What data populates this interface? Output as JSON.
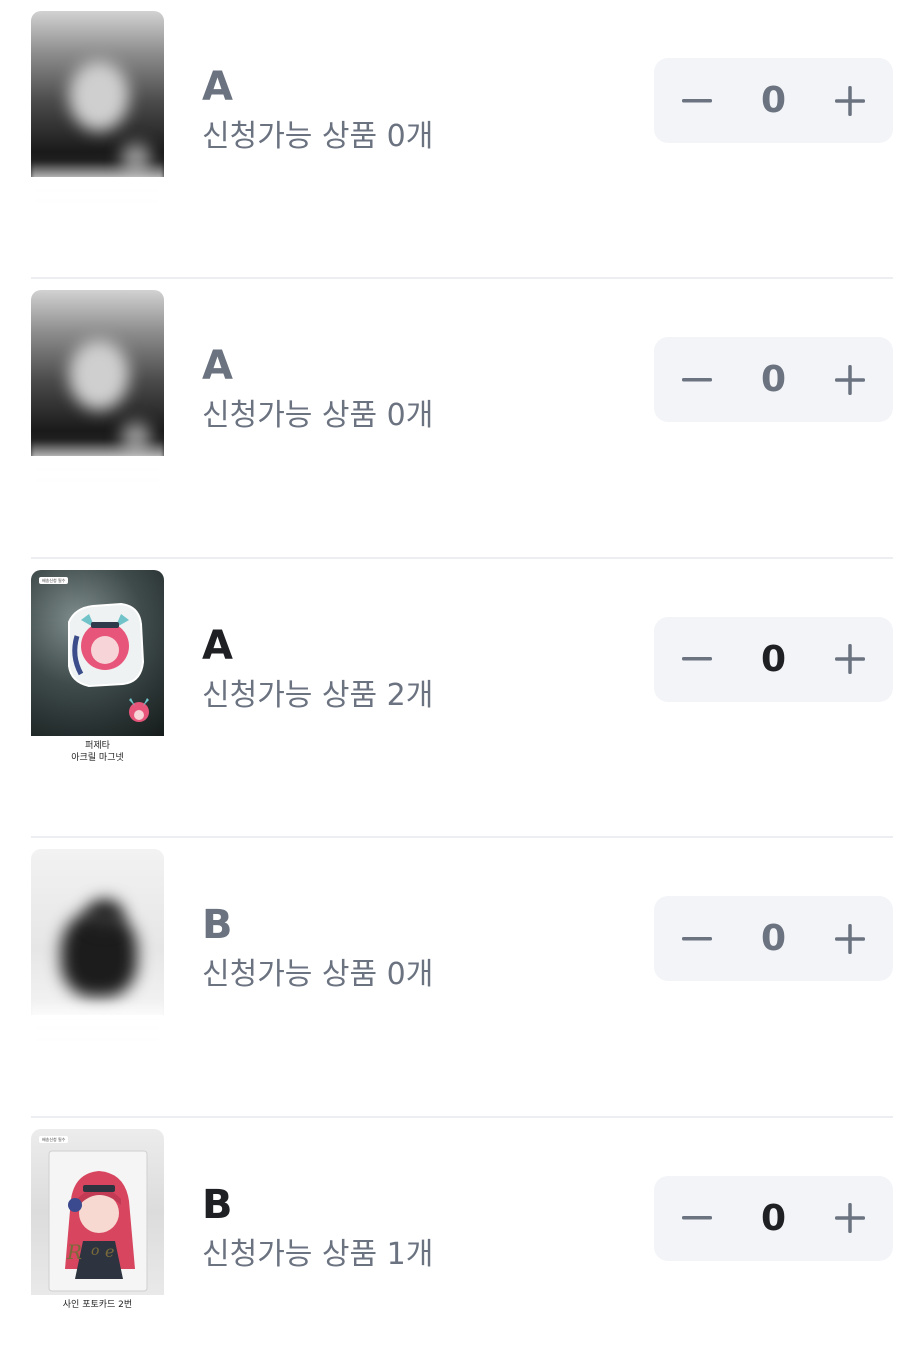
{
  "items": [
    {
      "grade": "A",
      "available": "신청가능 상품 0개",
      "count": "0",
      "caption": "",
      "tag": "",
      "thumb_style": "blurred-dark"
    },
    {
      "grade": "A",
      "available": "신청가능 상품 0개",
      "count": "0",
      "caption": "",
      "tag": "",
      "thumb_style": "blurred-dark"
    },
    {
      "grade": "A",
      "available": "신청가능 상품 2개",
      "count": "0",
      "caption": "퍼제타\n아크릴 마그넷",
      "tag": "배송신청 필수",
      "thumb_style": "photo-acrylic-magnet"
    },
    {
      "grade": "B",
      "available": "신청가능 상품 0개",
      "count": "0",
      "caption": "",
      "tag": "",
      "thumb_style": "blurred-light"
    },
    {
      "grade": "B",
      "available": "신청가능 상품 1개",
      "count": "0",
      "caption": "사인 포토카드 2번",
      "tag": "배송신청 필수",
      "thumb_style": "photo-photocard"
    }
  ],
  "icons": {
    "decrement": "minus-icon",
    "increment": "plus-icon"
  },
  "colors": {
    "text_primary": "#1f2024",
    "text_muted": "#6b7280",
    "stepper_bg": "#f2f4f7",
    "divider": "#eceef1",
    "accent_pink": "#e8557a"
  }
}
